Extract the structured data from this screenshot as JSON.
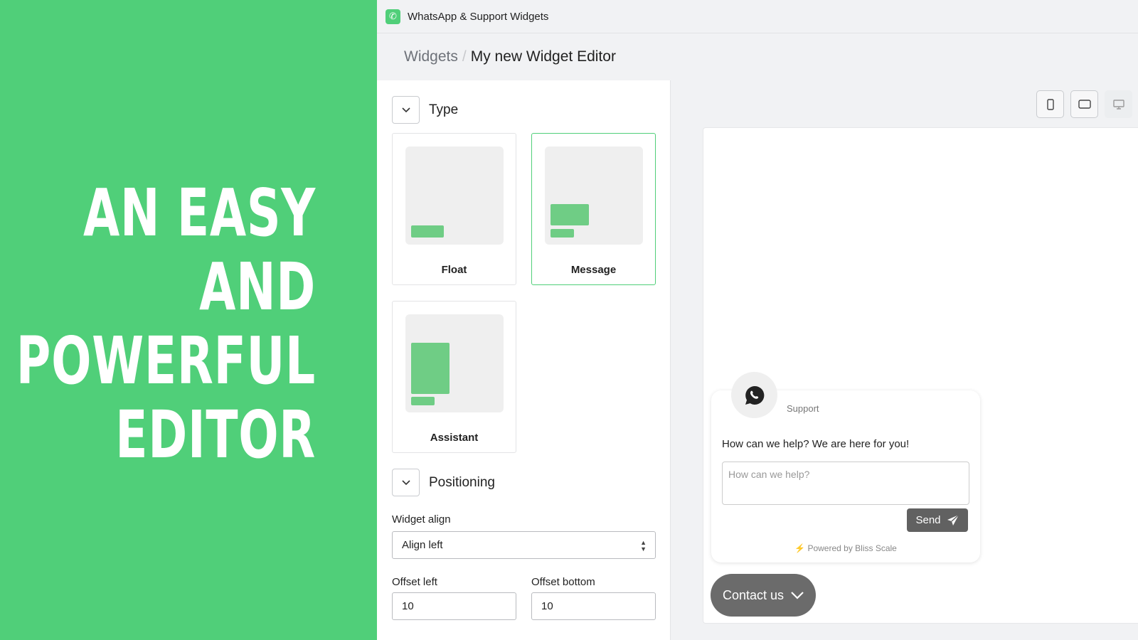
{
  "promo": {
    "lines": [
      "AN EASY",
      "AND",
      "POWERFUL",
      "EDITOR"
    ]
  },
  "app": {
    "title": "WhatsApp & Support Widgets",
    "icon": "whatsapp-icon",
    "brand_color": "#50cf79"
  },
  "breadcrumb": {
    "parent": "Widgets",
    "separator": "/",
    "current": "My new Widget Editor"
  },
  "editor": {
    "type_section": {
      "title": "Type",
      "options": [
        {
          "label": "Float",
          "selected": false
        },
        {
          "label": "Message",
          "selected": true
        },
        {
          "label": "Assistant",
          "selected": false
        }
      ]
    },
    "positioning_section": {
      "title": "Positioning",
      "widget_align": {
        "label": "Widget align",
        "value": "Align left"
      },
      "offset_left": {
        "label": "Offset left",
        "value": "10"
      },
      "offset_bottom": {
        "label": "Offset bottom",
        "value": "10"
      }
    }
  },
  "devices": [
    {
      "name": "mobile",
      "active": true
    },
    {
      "name": "tablet",
      "active": true
    },
    {
      "name": "desktop",
      "active": false
    }
  ],
  "widget": {
    "name": "Support",
    "message": "How can we help? We are here for you!",
    "placeholder": "How can we help?",
    "send_label": "Send",
    "powered": "Powered by Bliss Scale",
    "contact_label": "Contact us"
  }
}
